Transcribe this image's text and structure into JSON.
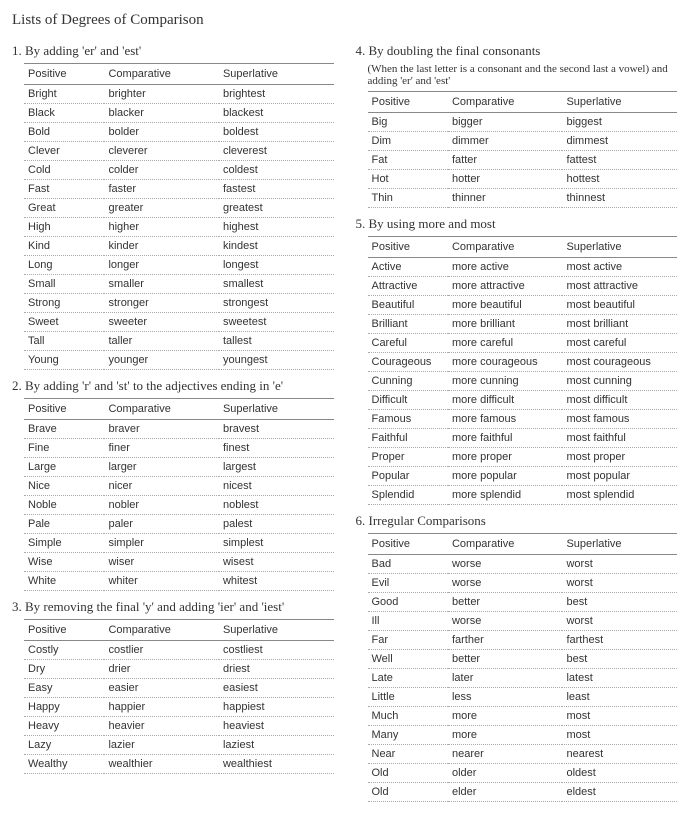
{
  "title": "Lists of Degrees of Comparison",
  "columns": {
    "pos": "Positive",
    "comp": "Comparative",
    "sup": "Superlative"
  },
  "s1": {
    "title": "1. By adding 'er' and 'est'",
    "rows": [
      [
        "Bright",
        "brighter",
        "brightest"
      ],
      [
        "Black",
        "blacker",
        "blackest"
      ],
      [
        "Bold",
        "bolder",
        "boldest"
      ],
      [
        "Clever",
        "cleverer",
        "cleverest"
      ],
      [
        "Cold",
        "colder",
        "coldest"
      ],
      [
        "Fast",
        "faster",
        "fastest"
      ],
      [
        "Great",
        "greater",
        "greatest"
      ],
      [
        "High",
        "higher",
        "highest"
      ],
      [
        "Kind",
        "kinder",
        "kindest"
      ],
      [
        "Long",
        "longer",
        "longest"
      ],
      [
        "Small",
        "smaller",
        "smallest"
      ],
      [
        "Strong",
        "stronger",
        "strongest"
      ],
      [
        "Sweet",
        "sweeter",
        "sweetest"
      ],
      [
        "Tall",
        "taller",
        "tallest"
      ],
      [
        "Young",
        "younger",
        "youngest"
      ]
    ]
  },
  "s2": {
    "title": "2. By adding 'r' and 'st' to the adjectives ending in 'e'",
    "rows": [
      [
        "Brave",
        "braver",
        "bravest"
      ],
      [
        "Fine",
        "finer",
        "finest"
      ],
      [
        "Large",
        "larger",
        "largest"
      ],
      [
        "Nice",
        "nicer",
        "nicest"
      ],
      [
        "Noble",
        "nobler",
        "noblest"
      ],
      [
        "Pale",
        "paler",
        "palest"
      ],
      [
        "Simple",
        "simpler",
        "simplest"
      ],
      [
        "Wise",
        "wiser",
        "wisest"
      ],
      [
        "White",
        "whiter",
        "whitest"
      ]
    ]
  },
  "s3": {
    "title": "3. By removing the final 'y' and adding 'ier' and 'iest'",
    "rows": [
      [
        "Costly",
        "costlier",
        "costliest"
      ],
      [
        "Dry",
        "drier",
        "driest"
      ],
      [
        "Easy",
        "easier",
        "easiest"
      ],
      [
        "Happy",
        "happier",
        "happiest"
      ],
      [
        "Heavy",
        "heavier",
        "heaviest"
      ],
      [
        "Lazy",
        "lazier",
        "laziest"
      ],
      [
        "Wealthy",
        "wealthier",
        "wealthiest"
      ]
    ]
  },
  "s4": {
    "title": "4. By doubling the final consonants",
    "note": "(When the last letter is a consonant and the second last a vowel) and adding 'er' and 'est'",
    "rows": [
      [
        "Big",
        "bigger",
        "biggest"
      ],
      [
        "Dim",
        "dimmer",
        "dimmest"
      ],
      [
        "Fat",
        "fatter",
        "fattest"
      ],
      [
        "Hot",
        "hotter",
        "hottest"
      ],
      [
        "Thin",
        "thinner",
        "thinnest"
      ]
    ]
  },
  "s5": {
    "title": "5. By using more and most",
    "rows": [
      [
        "Active",
        "more active",
        "most active"
      ],
      [
        "Attractive",
        "more attractive",
        "most attractive"
      ],
      [
        "Beautiful",
        "more beautiful",
        "most beautiful"
      ],
      [
        "Brilliant",
        "more brilliant",
        "most brilliant"
      ],
      [
        "Careful",
        "more careful",
        "most careful"
      ],
      [
        "Courageous",
        "more courageous",
        "most courageous"
      ],
      [
        "Cunning",
        "more cunning",
        "most cunning"
      ],
      [
        "Difficult",
        "more difficult",
        "most difficult"
      ],
      [
        "Famous",
        "more famous",
        "most famous"
      ],
      [
        "Faithful",
        "more faithful",
        "most faithful"
      ],
      [
        "Proper",
        "more proper",
        "most proper"
      ],
      [
        "Popular",
        "more popular",
        "most popular"
      ],
      [
        "Splendid",
        "more splendid",
        "most splendid"
      ]
    ]
  },
  "s6": {
    "title": "6. Irregular Comparisons",
    "rows": [
      [
        "Bad",
        "worse",
        "worst"
      ],
      [
        "Evil",
        "worse",
        "worst"
      ],
      [
        "Good",
        "better",
        "best"
      ],
      [
        "Ill",
        "worse",
        "worst"
      ],
      [
        "Far",
        "farther",
        "farthest"
      ],
      [
        "Well",
        "better",
        "best"
      ],
      [
        "Late",
        "later",
        "latest"
      ],
      [
        "Little",
        "less",
        "least"
      ],
      [
        "Much",
        "more",
        "most"
      ],
      [
        "Many",
        "more",
        "most"
      ],
      [
        "Near",
        "nearer",
        "nearest"
      ],
      [
        "Old",
        "older",
        "oldest"
      ],
      [
        "Old",
        "elder",
        "eldest"
      ]
    ]
  }
}
